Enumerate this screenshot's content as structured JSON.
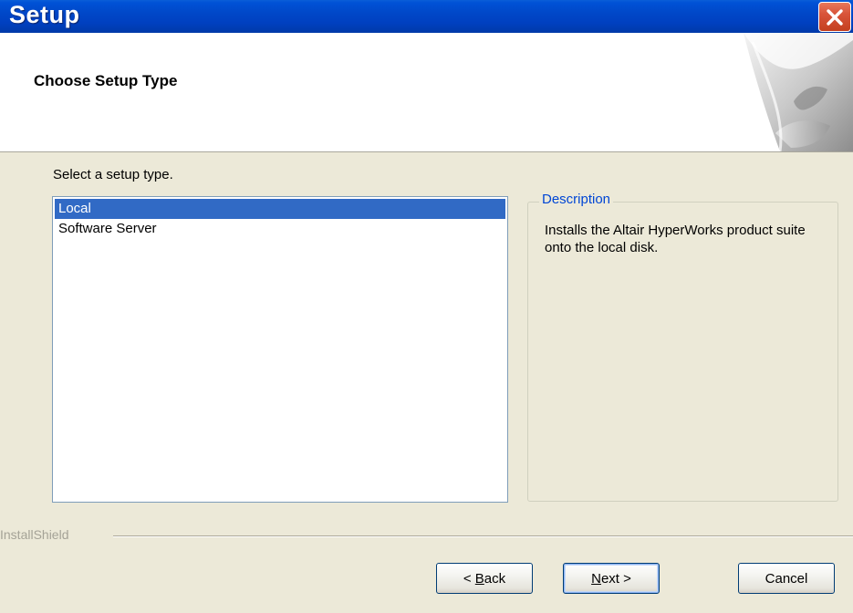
{
  "window": {
    "title": "Setup",
    "close_icon": "close-icon"
  },
  "header": {
    "title": "Choose Setup Type"
  },
  "body": {
    "prompt": "Select a setup type.",
    "setup_types": [
      {
        "label": "Local",
        "selected": true
      },
      {
        "label": "Software Server",
        "selected": false
      }
    ],
    "description_label": "Description",
    "description_text": "Installs the Altair HyperWorks product suite onto the local disk."
  },
  "footer": {
    "brand": "InstallShield",
    "back": {
      "prefix": "< ",
      "accel": "B",
      "rest": "ack"
    },
    "next": {
      "accel": "N",
      "rest": "ext",
      "suffix": " >"
    },
    "cancel": "Cancel"
  },
  "colors": {
    "titlebar": "#0047c8",
    "close_button": "#d8543a",
    "selection": "#316ac5",
    "group_label": "#0046d5",
    "face": "#ece9d8"
  }
}
